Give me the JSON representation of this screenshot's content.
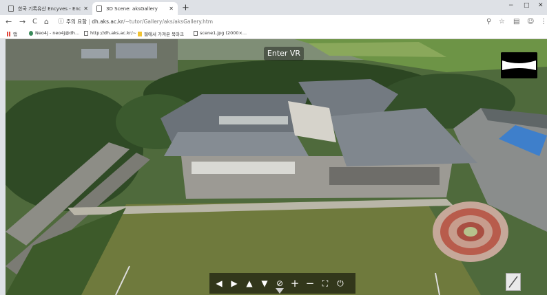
{
  "browser": {
    "tabs": [
      {
        "title": "한국 기록유산 Encyves - Encyve",
        "active": false
      },
      {
        "title": "3D Scene: aksGallery",
        "active": true
      }
    ],
    "new_tab": "+",
    "window_controls": {
      "minimize": "−",
      "maximize": "□",
      "close": "✕"
    },
    "nav": {
      "back": "←",
      "forward": "→",
      "reload": "C",
      "home": "⌂"
    },
    "security": "주의 요함",
    "url_domain": "dh.aks.ac.kr",
    "url_path": "/~tutor/Gallery/aks/aksGallery.htm",
    "toolbar_icons": [
      "zoom-icon",
      "star-icon",
      "extension-icon",
      "profile-icon",
      "menu-icon"
    ]
  },
  "bookmarks": [
    {
      "label": "앱",
      "icon": "apps-icon"
    },
    {
      "label": "Neo4j - neo4j@dh...",
      "icon": "neo4j-icon"
    },
    {
      "label": "http://dh.aks.ac.kr/~",
      "icon": "page-icon"
    },
    {
      "label": "웹에서 가져온 북마크",
      "icon": "folder-icon"
    },
    {
      "label": "scene1.jpg (2000×...",
      "icon": "page-icon"
    }
  ],
  "viewer": {
    "enter_vr": "Enter VR",
    "controls": [
      {
        "name": "pan-left-button",
        "glyph": "◀"
      },
      {
        "name": "pan-right-button",
        "glyph": "▶"
      },
      {
        "name": "pan-up-button",
        "glyph": "▲"
      },
      {
        "name": "pan-down-button",
        "glyph": "▼"
      },
      {
        "name": "hide-hotspots-button",
        "glyph": "⊘"
      },
      {
        "name": "zoom-in-button",
        "glyph": "+"
      },
      {
        "name": "zoom-out-button",
        "glyph": "−"
      },
      {
        "name": "fullscreen-button",
        "glyph": "⛶"
      },
      {
        "name": "autorotate-button",
        "glyph": "⏻"
      }
    ]
  }
}
